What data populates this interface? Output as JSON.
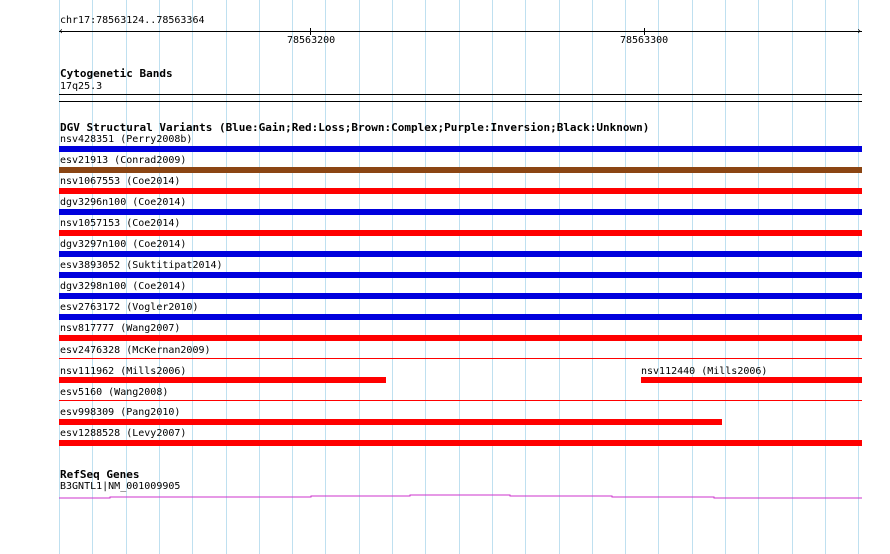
{
  "ruler": {
    "position": "chr17:78563124..78563364",
    "tick_labels": [
      "78563200",
      "78563300"
    ]
  },
  "cytoband": {
    "title": "Cytogenetic Bands",
    "band": "17q25.3"
  },
  "dgv": {
    "title": "DGV Structural Variants (Blue:Gain;Red:Loss;Brown:Complex;Purple:Inversion;Black:Unknown)",
    "colors": {
      "gain": "#0000dd",
      "loss": "#ff0000",
      "complex": "#8b4513"
    },
    "variants": [
      {
        "label": "nsv428351 (Perry2008b)",
        "type": "gain",
        "style": "bar"
      },
      {
        "label": "esv21913 (Conrad2009)",
        "type": "complex",
        "style": "bar"
      },
      {
        "label": "nsv1067553 (Coe2014)",
        "type": "loss",
        "style": "bar"
      },
      {
        "label": "dgv3296n100 (Coe2014)",
        "type": "gain",
        "style": "bar"
      },
      {
        "label": "nsv1057153 (Coe2014)",
        "type": "loss",
        "style": "bar"
      },
      {
        "label": "dgv3297n100 (Coe2014)",
        "type": "gain",
        "style": "bar"
      },
      {
        "label": "esv3893052 (Suktitipat2014)",
        "type": "gain",
        "style": "bar"
      },
      {
        "label": "dgv3298n100 (Coe2014)",
        "type": "gain",
        "style": "bar"
      },
      {
        "label": "esv2763172 (Vogler2010)",
        "type": "gain",
        "style": "bar"
      },
      {
        "label": "nsv817777 (Wang2007)",
        "type": "loss",
        "style": "bar"
      },
      {
        "label": "esv2476328 (McKernan2009)",
        "type": "loss",
        "style": "line"
      },
      {
        "label": "nsv111962 (Mills2006)",
        "type": "loss",
        "style": "bar"
      },
      {
        "label": "nsv112440 (Mills2006)",
        "type": "loss",
        "style": "bar"
      },
      {
        "label": "esv5160 (Wang2008)",
        "type": "loss",
        "style": "line"
      },
      {
        "label": "esv998309 (Pang2010)",
        "type": "loss",
        "style": "bar"
      },
      {
        "label": "esv1288528 (Levy2007)",
        "type": "loss",
        "style": "bar"
      }
    ]
  },
  "refseq": {
    "title": "RefSeq Genes",
    "gene_label": "B3GNTL1|NM_001009905",
    "color": "#cc33cc"
  }
}
